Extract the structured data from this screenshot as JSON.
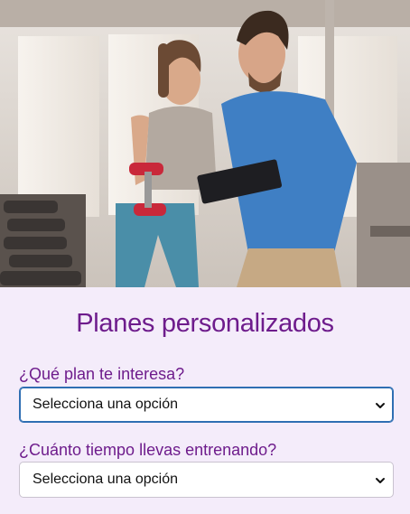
{
  "hero": {
    "image": "gym-trainer-photo"
  },
  "form": {
    "title": "Planes personalizados",
    "plan_label": "¿Qué plan te interesa?",
    "plan_value": "Selecciona una opción",
    "training_label": "¿Cuánto tiempo llevas entrenando?",
    "training_value": "Selecciona una opción"
  },
  "colors": {
    "accent": "#6e1c8c",
    "panel_bg": "#f4ecfa",
    "focus_border": "#2f6fb3"
  }
}
